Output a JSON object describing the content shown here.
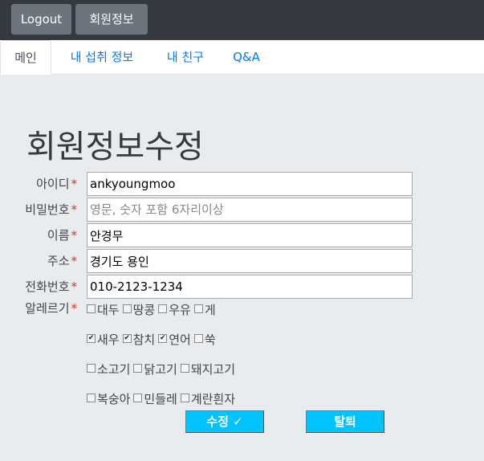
{
  "header": {
    "logout_label": "Logout",
    "member_info_label": "회원정보"
  },
  "tabs": [
    {
      "label": "메인",
      "active": true
    },
    {
      "label": "내 섭취 정보",
      "active": false
    },
    {
      "label": "내 친구",
      "active": false
    },
    {
      "label": "Q&A",
      "active": false
    }
  ],
  "form": {
    "title": "회원정보수정",
    "fields": {
      "id": {
        "label": "아이디",
        "value": "ankyoungmoo",
        "placeholder": ""
      },
      "password": {
        "label": "비밀번호",
        "value": "",
        "placeholder": "영문, 숫자 포함 6자리이상"
      },
      "name": {
        "label": "이름",
        "value": "안경무",
        "placeholder": ""
      },
      "address": {
        "label": "주소",
        "value": "경기도 용인",
        "placeholder": ""
      },
      "phone": {
        "label": "전화번호",
        "value": "010-2123-1234",
        "placeholder": ""
      }
    },
    "required_mark": "*",
    "allergy": {
      "label": "알레르기",
      "rows": [
        [
          {
            "label": "대두",
            "checked": false
          },
          {
            "label": "땅콩",
            "checked": false
          },
          {
            "label": "우유",
            "checked": false
          },
          {
            "label": "게",
            "checked": false
          }
        ],
        [
          {
            "label": "새우",
            "checked": true
          },
          {
            "label": "참치",
            "checked": true
          },
          {
            "label": "연어",
            "checked": true
          },
          {
            "label": "쑥",
            "checked": false
          }
        ],
        [
          {
            "label": "소고기",
            "checked": false
          },
          {
            "label": "닭고기",
            "checked": false
          },
          {
            "label": "돼지고기",
            "checked": false
          }
        ],
        [
          {
            "label": "복숭아",
            "checked": false
          },
          {
            "label": "민들레",
            "checked": false
          },
          {
            "label": "계란흰자",
            "checked": false
          }
        ]
      ]
    },
    "submit_label": "수정 ✓",
    "withdraw_label": "탈퇴"
  }
}
